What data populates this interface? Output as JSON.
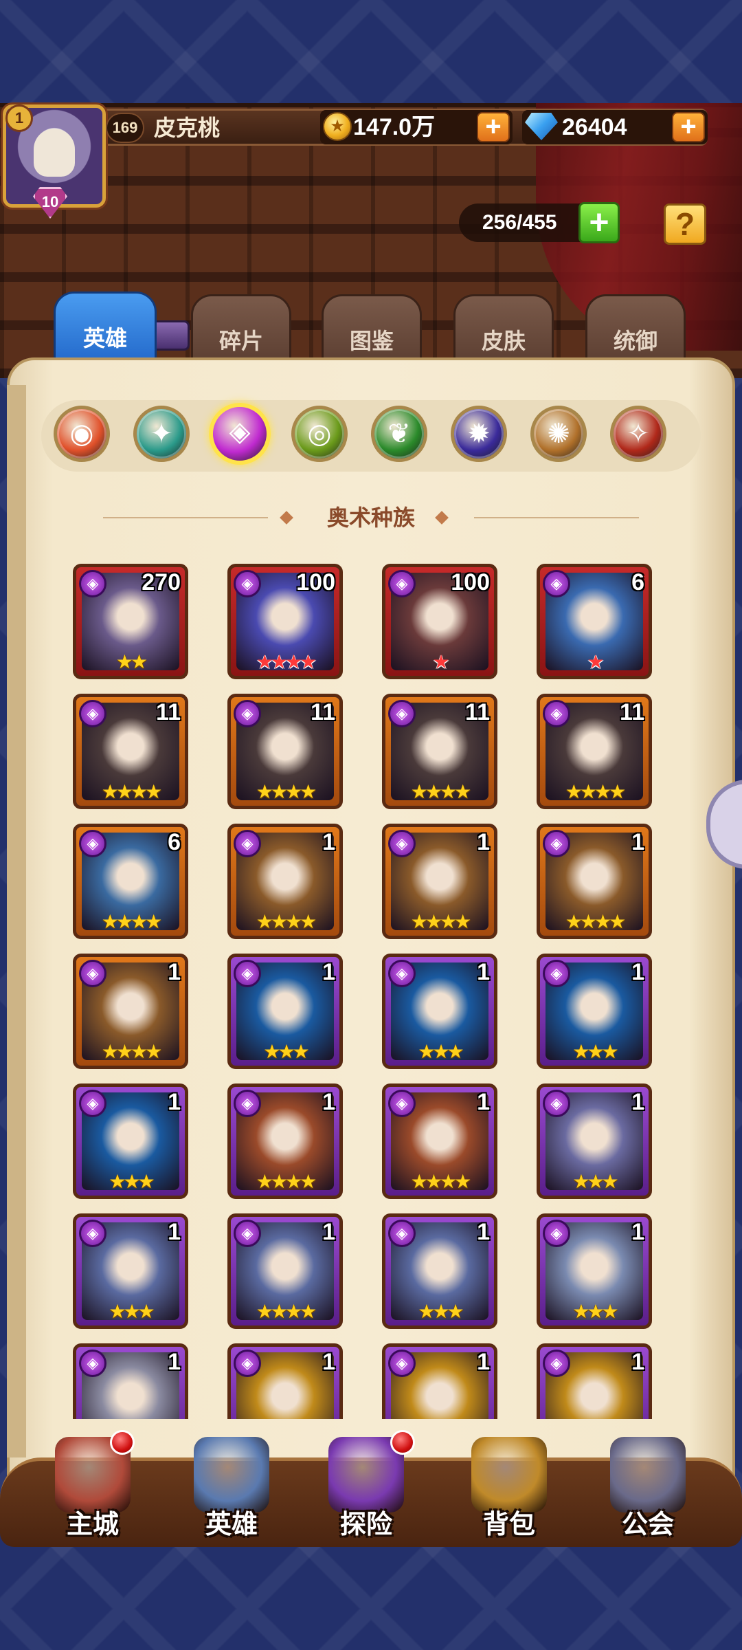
{
  "player": {
    "level": "169",
    "name": "皮克桃",
    "vip_level": "10",
    "rank_badge": "1"
  },
  "currency": {
    "gold": "147.0万",
    "gems": "26404",
    "plus_label": "+"
  },
  "capacity": {
    "value": "256/455",
    "plus_label": "+",
    "help_label": "?"
  },
  "tabs": [
    {
      "label": "英雄",
      "active": true
    },
    {
      "label": "碎片",
      "active": false
    },
    {
      "label": "图鉴",
      "active": false
    },
    {
      "label": "皮肤",
      "active": false
    },
    {
      "label": "统御",
      "active": false
    }
  ],
  "factions": [
    {
      "name": "all-factions-icon",
      "color": "#e0502a",
      "selected": false
    },
    {
      "name": "nature-faction-icon",
      "color": "#2a9a8a",
      "selected": false
    },
    {
      "name": "arcane-faction-icon",
      "color": "#c02ad0",
      "selected": true
    },
    {
      "name": "earth-faction-icon",
      "color": "#6a9a1a",
      "selected": false
    },
    {
      "name": "forest-faction-icon",
      "color": "#2a8a2a",
      "selected": false
    },
    {
      "name": "shadow-faction-icon",
      "color": "#3a2a9a",
      "selected": false
    },
    {
      "name": "light-faction-icon",
      "color": "#b0702a",
      "selected": false
    },
    {
      "name": "fire-faction-icon",
      "color": "#b0281a",
      "selected": false
    }
  ],
  "section_title": "奥术种族",
  "heroes": [
    {
      "level": "270",
      "frame": "red",
      "stars": "★★",
      "star_color": "gold",
      "art": "#6a5a8a"
    },
    {
      "level": "100",
      "frame": "red",
      "stars": "★★★★",
      "star_color": "red",
      "art": "#4a4ab0"
    },
    {
      "level": "100",
      "frame": "red",
      "stars": "★",
      "star_color": "red",
      "art": "#6a3a3a"
    },
    {
      "level": "6",
      "frame": "red",
      "stars": "★",
      "star_color": "red",
      "art": "#3a6ab0"
    },
    {
      "level": "11",
      "frame": "orange",
      "stars": "★★★★",
      "star_color": "gold",
      "art": "#4a3a3a"
    },
    {
      "level": "11",
      "frame": "orange",
      "stars": "★★★★",
      "star_color": "gold",
      "art": "#4a3a3a"
    },
    {
      "level": "11",
      "frame": "orange",
      "stars": "★★★★",
      "star_color": "gold",
      "art": "#4a3a3a"
    },
    {
      "level": "11",
      "frame": "orange",
      "stars": "★★★★",
      "star_color": "gold",
      "art": "#4a3a3a"
    },
    {
      "level": "6",
      "frame": "orange",
      "stars": "★★★★",
      "star_color": "gold",
      "art": "#3a6aa0"
    },
    {
      "level": "1",
      "frame": "orange",
      "stars": "★★★★",
      "star_color": "gold",
      "art": "#8a5a2a"
    },
    {
      "level": "1",
      "frame": "orange",
      "stars": "★★★★",
      "star_color": "gold",
      "art": "#8a5a2a"
    },
    {
      "level": "1",
      "frame": "orange",
      "stars": "★★★★",
      "star_color": "gold",
      "art": "#8a5a2a"
    },
    {
      "level": "1",
      "frame": "orange",
      "stars": "★★★★",
      "star_color": "gold",
      "art": "#8a5a2a"
    },
    {
      "level": "1",
      "frame": "purple",
      "stars": "★★★",
      "star_color": "gold",
      "art": "#1a5aa0"
    },
    {
      "level": "1",
      "frame": "purple",
      "stars": "★★★",
      "star_color": "gold",
      "art": "#1a5aa0"
    },
    {
      "level": "1",
      "frame": "purple",
      "stars": "★★★",
      "star_color": "gold",
      "art": "#1a5aa0"
    },
    {
      "level": "1",
      "frame": "purple",
      "stars": "★★★",
      "star_color": "gold",
      "art": "#1a5aa0"
    },
    {
      "level": "1",
      "frame": "purple",
      "stars": "★★★★",
      "star_color": "gold",
      "art": "#9a4a2a"
    },
    {
      "level": "1",
      "frame": "purple",
      "stars": "★★★★",
      "star_color": "gold",
      "art": "#9a4a2a"
    },
    {
      "level": "1",
      "frame": "purple",
      "stars": "★★★",
      "star_color": "gold",
      "art": "#6a6aa0"
    },
    {
      "level": "1",
      "frame": "purple",
      "stars": "★★★",
      "star_color": "gold",
      "art": "#5a6aa0"
    },
    {
      "level": "1",
      "frame": "purple",
      "stars": "★★★★",
      "star_color": "gold",
      "art": "#5a6aa0"
    },
    {
      "level": "1",
      "frame": "purple",
      "stars": "★★★",
      "star_color": "gold",
      "art": "#5a6aa0"
    },
    {
      "level": "1",
      "frame": "purple",
      "stars": "★★★",
      "star_color": "gold",
      "art": "#7a8ab0"
    },
    {
      "level": "1",
      "frame": "purple",
      "stars": "",
      "star_color": "gold",
      "art": "#8a8aa0"
    },
    {
      "level": "1",
      "frame": "purple",
      "stars": "",
      "star_color": "gold",
      "art": "#c08a1a"
    },
    {
      "level": "1",
      "frame": "purple",
      "stars": "",
      "star_color": "gold",
      "art": "#c08a1a"
    },
    {
      "level": "1",
      "frame": "purple",
      "stars": "",
      "star_color": "gold",
      "art": "#c08a1a"
    }
  ],
  "nav": [
    {
      "label": "主城",
      "icon": "castle-icon",
      "art": "#b04a3a",
      "dot": true
    },
    {
      "label": "英雄",
      "icon": "hero-portrait-icon",
      "art": "#5a7ab0",
      "dot": false
    },
    {
      "label": "探险",
      "icon": "portal-icon",
      "art": "#7a3ab0",
      "dot": true
    },
    {
      "label": "背包",
      "icon": "backpack-icon",
      "art": "#c08a2a",
      "dot": false
    },
    {
      "label": "公会",
      "icon": "guild-tower-icon",
      "art": "#6a6a8a",
      "dot": false
    }
  ]
}
